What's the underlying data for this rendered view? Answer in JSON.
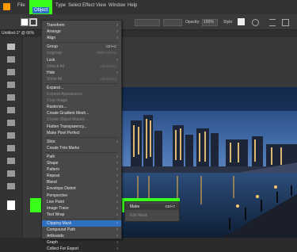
{
  "menubar": {
    "items": [
      "File",
      "Object",
      "Type",
      "Select",
      "Effect",
      "View",
      "Window",
      "Help"
    ],
    "active": "Object"
  },
  "controlbar": {
    "opacity_label": "Opacity:",
    "opacity_value": "100%",
    "style_label": "Style:"
  },
  "document_tab": {
    "label": "Untitled-1* @ 66%"
  },
  "object_menu": {
    "groups": [
      [
        {
          "label": "Transform",
          "submenu": true
        },
        {
          "label": "Arrange",
          "submenu": true
        },
        {
          "label": "Align",
          "submenu": true
        }
      ],
      [
        {
          "label": "Group",
          "shortcut": "Ctrl+G"
        },
        {
          "label": "Ungroup",
          "shortcut": "Shift+Ctrl+G",
          "disabled": true
        },
        {
          "label": "Lock",
          "submenu": true
        },
        {
          "label": "Unlock All",
          "shortcut": "Alt+Ctrl+2",
          "disabled": true
        },
        {
          "label": "Hide",
          "submenu": true
        },
        {
          "label": "Show All",
          "shortcut": "Alt+Ctrl+3",
          "disabled": true
        }
      ],
      [
        {
          "label": "Expand..."
        },
        {
          "label": "Expand Appearance",
          "disabled": true
        },
        {
          "label": "Crop Image",
          "disabled": true
        },
        {
          "label": "Rasterize..."
        },
        {
          "label": "Create Gradient Mesh..."
        },
        {
          "label": "Create Object Mosaic...",
          "disabled": true
        },
        {
          "label": "Flatten Transparency..."
        },
        {
          "label": "Make Pixel Perfect"
        }
      ],
      [
        {
          "label": "Slice",
          "submenu": true
        },
        {
          "label": "Create Trim Marks"
        }
      ],
      [
        {
          "label": "Path",
          "submenu": true
        },
        {
          "label": "Shape",
          "submenu": true
        },
        {
          "label": "Pattern",
          "submenu": true
        },
        {
          "label": "Repeat",
          "submenu": true
        },
        {
          "label": "Blend",
          "submenu": true
        },
        {
          "label": "Envelope Distort",
          "submenu": true
        },
        {
          "label": "Perspective",
          "submenu": true
        },
        {
          "label": "Live Paint",
          "submenu": true
        },
        {
          "label": "Image Trace",
          "submenu": true
        },
        {
          "label": "Text Wrap",
          "submenu": true
        }
      ],
      [
        {
          "label": "Clipping Mask",
          "submenu": true,
          "highlighted": true
        },
        {
          "label": "Compound Path",
          "submenu": true
        },
        {
          "label": "Artboards",
          "submenu": true
        },
        {
          "label": "Graph",
          "submenu": true
        },
        {
          "label": "Collect For Export",
          "submenu": true
        }
      ]
    ]
  },
  "clipping_submenu": {
    "items": [
      {
        "label": "Make",
        "shortcut": "Ctrl+7",
        "highlighted": true
      },
      {
        "label": "Edit Mask",
        "disabled": true
      }
    ]
  },
  "colors": {
    "highlight": "#39ff1a",
    "menu_bg": "#484848",
    "app_bg": "#2b2b2b"
  }
}
